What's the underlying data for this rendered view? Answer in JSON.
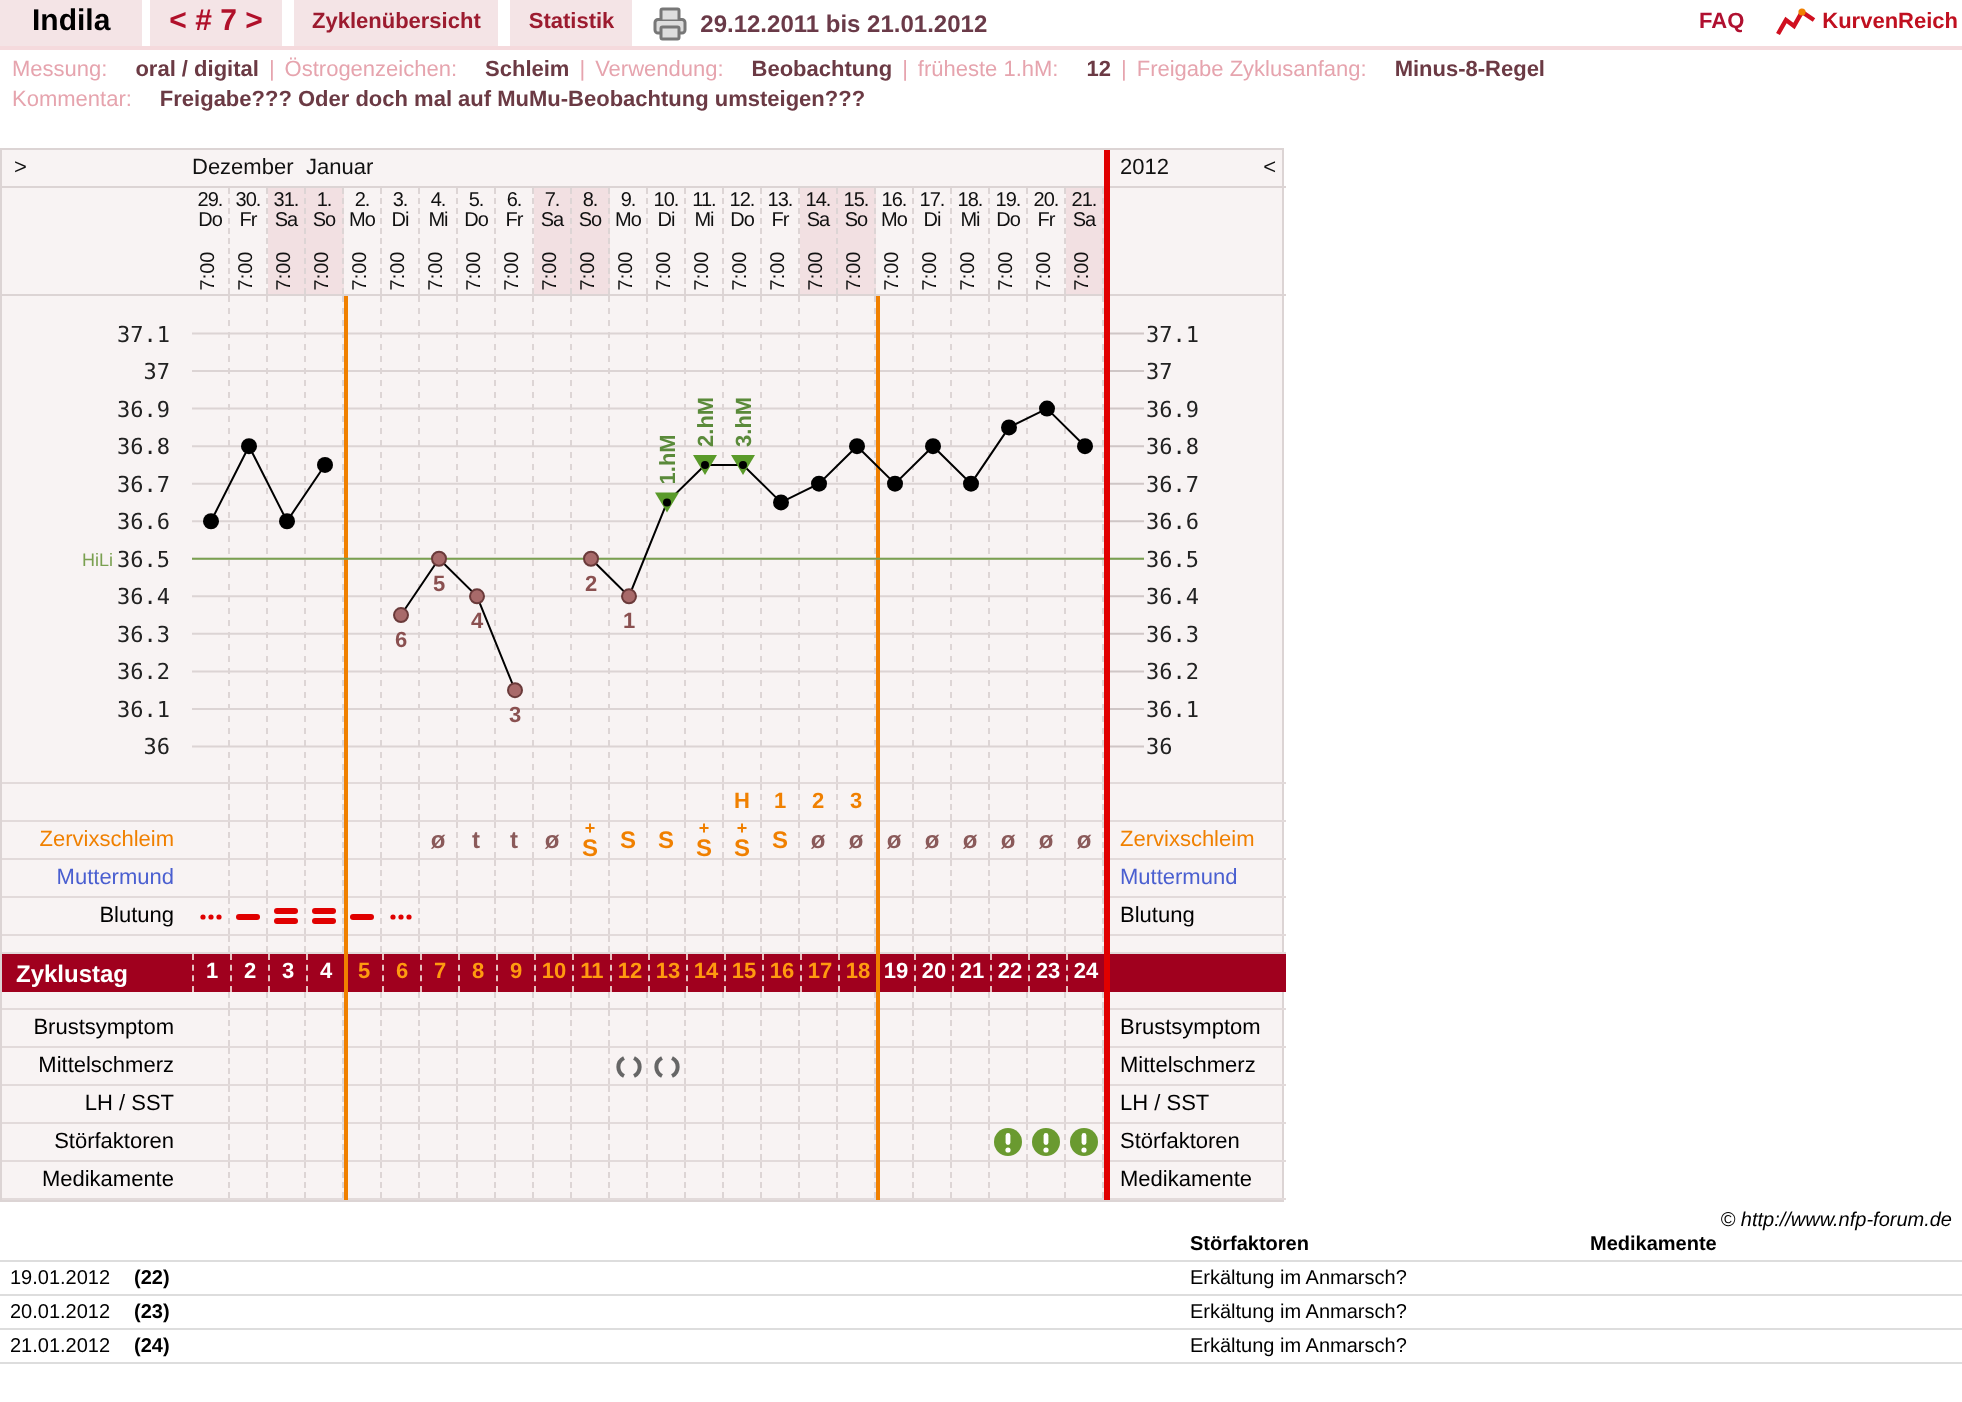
{
  "header": {
    "user": "Indila",
    "cycle_nav": "< # 7 >",
    "tabs": [
      {
        "label": "Zyklenübersicht"
      },
      {
        "label": "Statistik"
      }
    ],
    "date_range": "29.12.2011 bis 21.01.2012",
    "faq": "FAQ",
    "logo": "KurvenReich"
  },
  "info": {
    "separator": "|",
    "fields": [
      {
        "label": "Messung:",
        "value": "oral / digital"
      },
      {
        "label": "Östrogenzeichen:",
        "value": "Schleim"
      },
      {
        "label": "Verwendung:",
        "value": "Beobachtung"
      },
      {
        "label": "früheste 1.hM:",
        "value": "12"
      },
      {
        "label": "Freigabe Zyklusanfang:",
        "value": "Minus-8-Regel"
      }
    ],
    "comment": {
      "label": "Kommentar:",
      "value": "Freigabe??? Oder doch mal auf MuMu-Beobachtung umsteigen???"
    }
  },
  "chart": {
    "nav_left": ">",
    "nav_right": "<",
    "year": "2012",
    "days": [
      {
        "weekday": "Do",
        "time": "7:00",
        "month": "Dezember",
        "weekend": false,
        "fertile": false,
        "cycle_day": "1",
        "bleeding": {
          "kind": "dots"
        }
      },
      {
        "weekday": "Fr",
        "time": "7:00",
        "weekend": false,
        "fertile": false,
        "cycle_day": "2",
        "bleeding": {
          "kind": "dash"
        }
      },
      {
        "weekday": "Sa",
        "time": "7:00",
        "weekend": true,
        "fertile": false,
        "cycle_day": "3",
        "bleeding": {
          "kind": "double_dash"
        }
      },
      {
        "weekday": "So",
        "time": "7:00",
        "month": "Januar",
        "weekend": true,
        "fertile": false,
        "cycle_day": "4",
        "bleeding": {
          "kind": "double_dash"
        }
      },
      {
        "weekday": "Mo",
        "time": "7:00",
        "weekend": false,
        "fertile": true,
        "cycle_day": "5",
        "bleeding": {
          "kind": "dash"
        }
      },
      {
        "weekday": "Di",
        "time": "7:00",
        "weekend": false,
        "fertile": true,
        "cycle_day": "6",
        "bleeding": {
          "kind": "dots"
        },
        "marker": {
          "kind": "low"
        }
      },
      {
        "weekday": "Mi",
        "time": "7:00",
        "weekend": false,
        "fertile": true,
        "cycle_day": "7",
        "mucus": {
          "symbol": "ø",
          "color": "#8a5a5a"
        },
        "marker": {
          "kind": "low"
        }
      },
      {
        "weekday": "Do",
        "time": "7:00",
        "weekend": false,
        "fertile": true,
        "cycle_day": "8",
        "mucus": {
          "symbol": "t",
          "color": "#8a5a5a"
        },
        "marker": {
          "kind": "low"
        }
      },
      {
        "weekday": "Fr",
        "time": "7:00",
        "weekend": false,
        "fertile": true,
        "cycle_day": "9",
        "mucus": {
          "symbol": "t",
          "color": "#8a5a5a"
        },
        "marker": {
          "kind": "low"
        }
      },
      {
        "weekday": "Sa",
        "time": "7:00",
        "weekend": true,
        "fertile": true,
        "cycle_day": "10",
        "mucus": {
          "symbol": "ø",
          "color": "#8a5a5a"
        }
      },
      {
        "weekday": "So",
        "time": "7:00",
        "weekend": true,
        "fertile": true,
        "cycle_day": "11",
        "mucus": {
          "symbol": "S",
          "mark": "+",
          "color": "#f08000"
        },
        "marker": {
          "kind": "low"
        }
      },
      {
        "weekday": "Mo",
        "time": "7:00",
        "weekend": false,
        "fertile": true,
        "cycle_day": "12",
        "mucus": {
          "symbol": "S",
          "color": "#f08000"
        },
        "pain": true,
        "marker": {
          "kind": "low"
        }
      },
      {
        "weekday": "Di",
        "time": "7:00",
        "weekend": false,
        "fertile": true,
        "cycle_day": "13",
        "mucus": {
          "symbol": "S",
          "color": "#f08000"
        },
        "pain": true,
        "marker": {
          "kind": "peak"
        }
      },
      {
        "weekday": "Mi",
        "time": "7:00",
        "weekend": false,
        "fertile": true,
        "cycle_day": "14",
        "mucus": {
          "symbol": "S",
          "mark": "+",
          "color": "#f08000"
        },
        "marker": {
          "kind": "peak"
        }
      },
      {
        "weekday": "Do",
        "time": "7:00",
        "weekend": false,
        "fertile": true,
        "cycle_day": "15",
        "peak": "H",
        "mucus": {
          "symbol": "S",
          "mark": "+",
          "color": "#f08000"
        },
        "marker": {
          "kind": "peak"
        }
      },
      {
        "weekday": "Fr",
        "time": "7:00",
        "weekend": false,
        "fertile": true,
        "cycle_day": "16",
        "peak": "1",
        "mucus": {
          "symbol": "S",
          "color": "#f08000"
        }
      },
      {
        "weekday": "Sa",
        "time": "7:00",
        "weekend": true,
        "fertile": true,
        "cycle_day": "17",
        "peak": "2",
        "mucus": {
          "symbol": "ø",
          "color": "#8a5a5a"
        }
      },
      {
        "weekday": "So",
        "time": "7:00",
        "weekend": true,
        "fertile": true,
        "cycle_day": "18",
        "peak": "3",
        "mucus": {
          "symbol": "ø",
          "color": "#8a5a5a"
        }
      },
      {
        "weekday": "Mo",
        "time": "7:00",
        "weekend": false,
        "fertile": false,
        "cycle_day": "19",
        "mucus": {
          "symbol": "ø",
          "color": "#8a5a5a"
        }
      },
      {
        "weekday": "Di",
        "time": "7:00",
        "weekend": false,
        "fertile": false,
        "cycle_day": "20",
        "mucus": {
          "symbol": "ø",
          "color": "#8a5a5a"
        }
      },
      {
        "weekday": "Mi",
        "time": "7:00",
        "weekend": false,
        "fertile": false,
        "cycle_day": "21",
        "mucus": {
          "symbol": "ø",
          "color": "#8a5a5a"
        }
      },
      {
        "weekday": "Do",
        "time": "7:00",
        "weekend": false,
        "fertile": false,
        "cycle_day": "22",
        "mucus": {
          "symbol": "ø",
          "color": "#8a5a5a"
        },
        "disturbance": true
      },
      {
        "weekday": "Fr",
        "time": "7:00",
        "weekend": false,
        "fertile": false,
        "cycle_day": "23",
        "mucus": {
          "symbol": "ø",
          "color": "#8a5a5a"
        },
        "disturbance": true
      },
      {
        "weekday": "Sa",
        "time": "7:00",
        "weekend": true,
        "fertile": false,
        "cycle_day": "24",
        "mucus": {
          "symbol": "ø",
          "color": "#8a5a5a"
        },
        "disturbance": true
      }
    ],
    "chart_data": {
      "type": "line",
      "categories": [
        "29.",
        "30.",
        "31.",
        "1.",
        "2.",
        "3.",
        "4.",
        "5.",
        "6.",
        "7.",
        "8.",
        "9.",
        "10.",
        "11.",
        "12.",
        "13.",
        "14.",
        "15.",
        "16.",
        "17.",
        "18.",
        "19.",
        "20.",
        "21."
      ],
      "series": [
        {
          "color": "#000000",
          "marker": "circle",
          "values": [
            36.6,
            36.8,
            36.6,
            36.75,
            null,
            36.35,
            36.5,
            36.4,
            36.15,
            null,
            36.5,
            36.4,
            36.65,
            36.75,
            36.75,
            36.65,
            36.7,
            36.8,
            36.7,
            36.8,
            36.7,
            36.85,
            36.9,
            36.8
          ]
        }
      ],
      "ylim": [
        35.9,
        37.2
      ],
      "yticks": [
        36,
        36.1,
        36.2,
        36.3,
        36.4,
        36.5,
        36.6,
        36.7,
        36.8,
        36.9,
        37,
        37.1
      ],
      "grid": true,
      "ref_lines": [
        {
          "axis": "y",
          "value": 36.5,
          "label": "HiLi",
          "color": "#7aa050"
        }
      ],
      "annotations": [
        {
          "x": "3.",
          "y": 36.35,
          "text": "6"
        },
        {
          "x": "4.",
          "y": 36.5,
          "text": "5"
        },
        {
          "x": "5.",
          "y": 36.4,
          "text": "4"
        },
        {
          "x": "6.",
          "y": 36.15,
          "text": "3"
        },
        {
          "x": "8.",
          "y": 36.5,
          "text": "2"
        },
        {
          "x": "9.",
          "y": 36.4,
          "text": "1"
        },
        {
          "x": "10.",
          "y": 36.65,
          "text": "1.hM"
        },
        {
          "x": "11.",
          "y": 36.75,
          "text": "2.hM"
        },
        {
          "x": "12.",
          "y": 36.75,
          "text": "3.hM"
        }
      ]
    },
    "right_axis": [
      "37.1",
      "37",
      "36.9",
      "36.8",
      "36.7",
      "36.6",
      "36.5",
      "36.4",
      "36.3",
      "36.2",
      "36.1",
      "36"
    ],
    "rows": [
      {
        "kind": "mucus",
        "label": "Zervixschleim",
        "label_right": "Zervixschleim",
        "color": "#f08000"
      },
      {
        "kind": "cervix",
        "label": "Muttermund",
        "label_right": "Muttermund",
        "color": "#4a5fd0"
      },
      {
        "kind": "bleeding",
        "label": "Blutung",
        "label_right": "Blutung",
        "color": "#000000"
      },
      {
        "kind": "cycle_day",
        "label": "Zyklustag"
      },
      {
        "kind": "breast",
        "label": "Brustsymptom",
        "label_right": "Brustsymptom",
        "color": "#000000"
      },
      {
        "kind": "pain",
        "label": "Mittelschmerz",
        "label_right": "Mittelschmerz",
        "color": "#000000"
      },
      {
        "kind": "lh",
        "label": "LH / SST",
        "label_right": "LH / SST",
        "color": "#000000"
      },
      {
        "kind": "disturbance",
        "label": "Störfaktoren",
        "label_right": "Störfaktoren",
        "color": "#000000"
      },
      {
        "kind": "medication",
        "label": "Medikamente",
        "label_right": "Medikamente",
        "color": "#000000"
      }
    ]
  },
  "copyright": "© http://www.nfp-forum.de",
  "notes": {
    "columns": [
      "Störfaktoren",
      "Medikamente"
    ],
    "rows": [
      {
        "date": "19.01.2012",
        "cycle_day": "(22)",
        "disturbance": "Erkältung im Anmarsch?"
      },
      {
        "date": "20.01.2012",
        "cycle_day": "(23)",
        "disturbance": "Erkältung im Anmarsch?"
      },
      {
        "date": "21.01.2012",
        "cycle_day": "(24)",
        "disturbance": "Erkältung im Anmarsch?"
      }
    ]
  }
}
